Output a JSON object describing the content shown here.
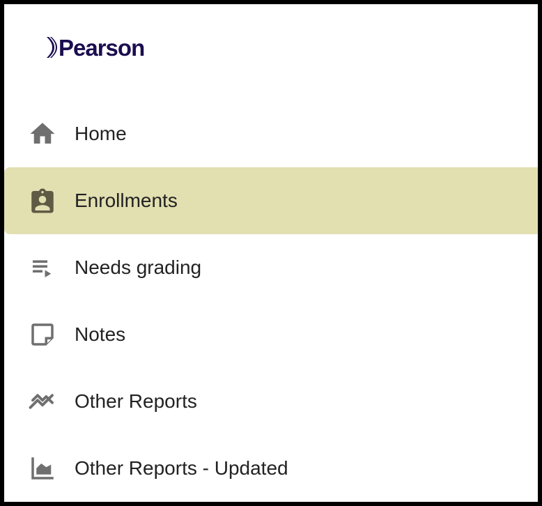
{
  "brand": {
    "name": "Pearson",
    "color": "#1b0d4f"
  },
  "nav": {
    "items": [
      {
        "label": "Home",
        "icon": "home-icon",
        "active": false
      },
      {
        "label": "Enrollments",
        "icon": "badge-icon",
        "active": true
      },
      {
        "label": "Needs grading",
        "icon": "playlist-play-icon",
        "active": false
      },
      {
        "label": "Notes",
        "icon": "sticky-note-icon",
        "active": false
      },
      {
        "label": "Other Reports",
        "icon": "trending-icon",
        "active": false
      },
      {
        "label": "Other Reports - Updated",
        "icon": "area-chart-icon",
        "active": false
      }
    ],
    "active_color": "#e2dfb1",
    "icon_color": "#6f6f6f",
    "active_icon_color": "#5f5a44"
  }
}
